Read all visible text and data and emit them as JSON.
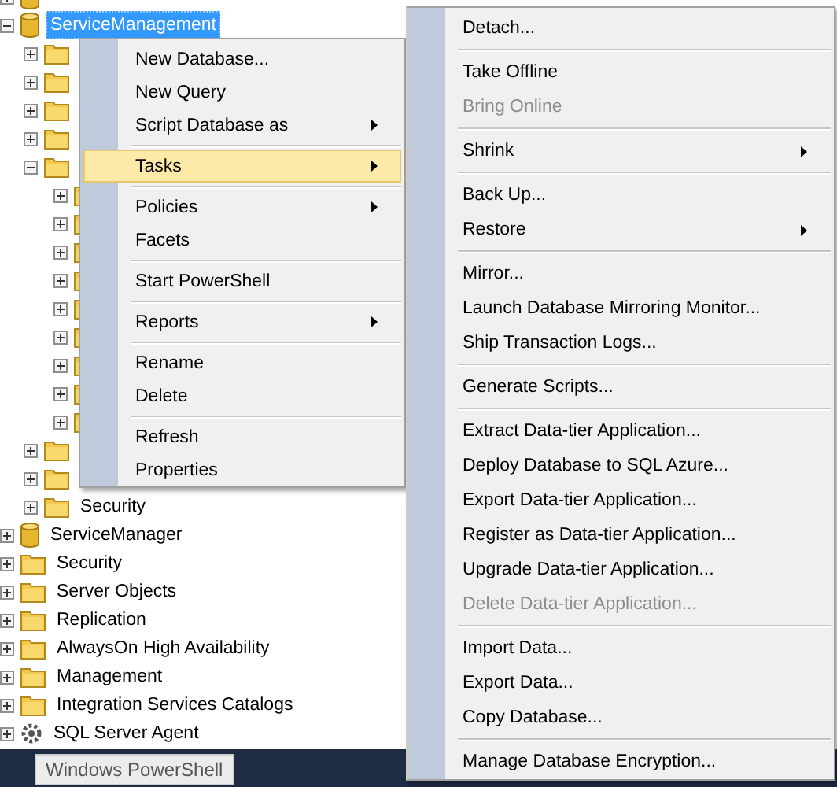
{
  "tree": {
    "items": [
      {
        "kind": "group",
        "children": [
          {
            "kind": "database",
            "expanded": false
          },
          {
            "kind": "database",
            "label": "ServiceManagement",
            "expanded": true,
            "selected": true,
            "children": [
              {
                "kind": "folder",
                "expanded": false
              },
              {
                "kind": "folder",
                "expanded": false
              },
              {
                "kind": "folder",
                "expanded": false
              },
              {
                "kind": "folder",
                "expanded": false
              },
              {
                "kind": "folder",
                "expanded": true,
                "children": [
                  {
                    "kind": "folder",
                    "expanded": false
                  },
                  {
                    "kind": "folder",
                    "expanded": false
                  },
                  {
                    "kind": "folder",
                    "expanded": false
                  },
                  {
                    "kind": "folder",
                    "expanded": false
                  },
                  {
                    "kind": "folder",
                    "expanded": false
                  },
                  {
                    "kind": "folder",
                    "expanded": false
                  },
                  {
                    "kind": "folder",
                    "expanded": false
                  },
                  {
                    "kind": "folder",
                    "expanded": false
                  },
                  {
                    "kind": "folder",
                    "expanded": false
                  }
                ]
              },
              {
                "kind": "folder",
                "expanded": false
              },
              {
                "kind": "folder",
                "expanded": false
              },
              {
                "kind": "folder",
                "label": "Security",
                "expanded": false,
                "selected": false
              }
            ]
          },
          {
            "kind": "database",
            "label": "ServiceManager",
            "expanded": false,
            "selected": false
          }
        ]
      },
      {
        "kind": "folder",
        "label": "Security",
        "expanded": false,
        "selected": false
      },
      {
        "kind": "folder",
        "label": "Server Objects",
        "expanded": false,
        "selected": false
      },
      {
        "kind": "folder",
        "label": "Replication",
        "expanded": false,
        "selected": false
      },
      {
        "kind": "folder",
        "label": "AlwaysOn High Availability",
        "expanded": false,
        "selected": false
      },
      {
        "kind": "folder",
        "label": "Management",
        "expanded": false,
        "selected": false
      },
      {
        "kind": "folder",
        "label": "Integration Services Catalogs",
        "expanded": false,
        "selected": false
      },
      {
        "kind": "agent",
        "label": "SQL Server Agent",
        "expanded": false,
        "selected": false
      }
    ]
  },
  "context_menu": {
    "items": [
      {
        "kind": "item",
        "label": "New Database...",
        "submenu": false,
        "selected": false
      },
      {
        "kind": "item",
        "label": "New Query",
        "submenu": false,
        "selected": false
      },
      {
        "kind": "item",
        "label": "Script Database as",
        "submenu": true,
        "selected": false
      },
      {
        "kind": "separator"
      },
      {
        "kind": "item",
        "label": "Tasks",
        "submenu": true,
        "selected": true
      },
      {
        "kind": "separator"
      },
      {
        "kind": "item",
        "label": "Policies",
        "submenu": true,
        "selected": false
      },
      {
        "kind": "item",
        "label": "Facets",
        "submenu": false,
        "selected": false
      },
      {
        "kind": "separator"
      },
      {
        "kind": "item",
        "label": "Start PowerShell",
        "submenu": false,
        "selected": false
      },
      {
        "kind": "separator"
      },
      {
        "kind": "item",
        "label": "Reports",
        "submenu": true,
        "selected": false
      },
      {
        "kind": "separator"
      },
      {
        "kind": "item",
        "label": "Rename",
        "submenu": false,
        "selected": false
      },
      {
        "kind": "item",
        "label": "Delete",
        "submenu": false,
        "selected": false
      },
      {
        "kind": "separator"
      },
      {
        "kind": "item",
        "label": "Refresh",
        "submenu": false,
        "selected": false
      },
      {
        "kind": "item",
        "label": "Properties",
        "submenu": false,
        "selected": false
      }
    ]
  },
  "tasks_submenu": {
    "items": [
      {
        "kind": "item",
        "label": "Detach...",
        "submenu": false,
        "disabled": false
      },
      {
        "kind": "separator"
      },
      {
        "kind": "item",
        "label": "Take Offline",
        "submenu": false,
        "disabled": false
      },
      {
        "kind": "item",
        "label": "Bring Online",
        "submenu": false,
        "disabled": true
      },
      {
        "kind": "separator"
      },
      {
        "kind": "item",
        "label": "Shrink",
        "submenu": true,
        "disabled": false
      },
      {
        "kind": "separator"
      },
      {
        "kind": "item",
        "label": "Back Up...",
        "submenu": false,
        "disabled": false
      },
      {
        "kind": "item",
        "label": "Restore",
        "submenu": true,
        "disabled": false
      },
      {
        "kind": "separator"
      },
      {
        "kind": "item",
        "label": "Mirror...",
        "submenu": false,
        "disabled": false
      },
      {
        "kind": "item",
        "label": "Launch Database Mirroring Monitor...",
        "submenu": false,
        "disabled": false
      },
      {
        "kind": "item",
        "label": "Ship Transaction Logs...",
        "submenu": false,
        "disabled": false
      },
      {
        "kind": "separator"
      },
      {
        "kind": "item",
        "label": "Generate Scripts...",
        "submenu": false,
        "disabled": false
      },
      {
        "kind": "separator"
      },
      {
        "kind": "item",
        "label": "Extract Data-tier Application...",
        "submenu": false,
        "disabled": false
      },
      {
        "kind": "item",
        "label": "Deploy Database to SQL Azure...",
        "submenu": false,
        "disabled": false
      },
      {
        "kind": "item",
        "label": "Export Data-tier Application...",
        "submenu": false,
        "disabled": false
      },
      {
        "kind": "item",
        "label": "Register as Data-tier Application...",
        "submenu": false,
        "disabled": false
      },
      {
        "kind": "item",
        "label": "Upgrade Data-tier Application...",
        "submenu": false,
        "disabled": false
      },
      {
        "kind": "item",
        "label": "Delete Data-tier Application...",
        "submenu": false,
        "disabled": true
      },
      {
        "kind": "separator"
      },
      {
        "kind": "item",
        "label": "Import Data...",
        "submenu": false,
        "disabled": false
      },
      {
        "kind": "item",
        "label": "Export Data...",
        "submenu": false,
        "disabled": false
      },
      {
        "kind": "item",
        "label": "Copy Database...",
        "submenu": false,
        "disabled": false
      },
      {
        "kind": "separator"
      },
      {
        "kind": "item",
        "label": "Manage Database Encryption...",
        "submenu": false,
        "disabled": false
      }
    ]
  },
  "taskbar": {
    "tooltip": "Windows PowerShell"
  }
}
